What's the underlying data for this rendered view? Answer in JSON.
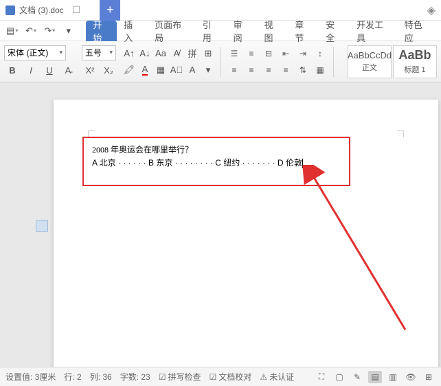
{
  "title_tab": {
    "filename": "文档 (3).doc"
  },
  "ribbon_tabs": [
    "开始",
    "插入",
    "页面布局",
    "引用",
    "审阅",
    "视图",
    "章节",
    "安全",
    "开发工具",
    "特色应"
  ],
  "active_tab_index": 0,
  "font": {
    "name": "宋体 (正文)",
    "size": "五号"
  },
  "styles": [
    {
      "preview": "AaBbCcDd",
      "label": "正文"
    },
    {
      "preview": "AaBb",
      "label": "标题 1"
    }
  ],
  "document": {
    "line1": "2008 年奥运会在哪里举行？",
    "line2": "A 北京 · · · · · · B 东京 · · · · · · · · C 纽约 · · · · · · · D 伦敦"
  },
  "status": {
    "setting": "设置值: 3厘米",
    "row": "行: 2",
    "col": "列: 36",
    "chars": "字数: 23",
    "spell": "拼写检查",
    "proof": "文档校对",
    "auth": "未认证"
  },
  "icons": {
    "close": "☐",
    "add": "+",
    "menu": "▤",
    "undo": "↶",
    "redo": "↷",
    "search_dd": "▾"
  }
}
